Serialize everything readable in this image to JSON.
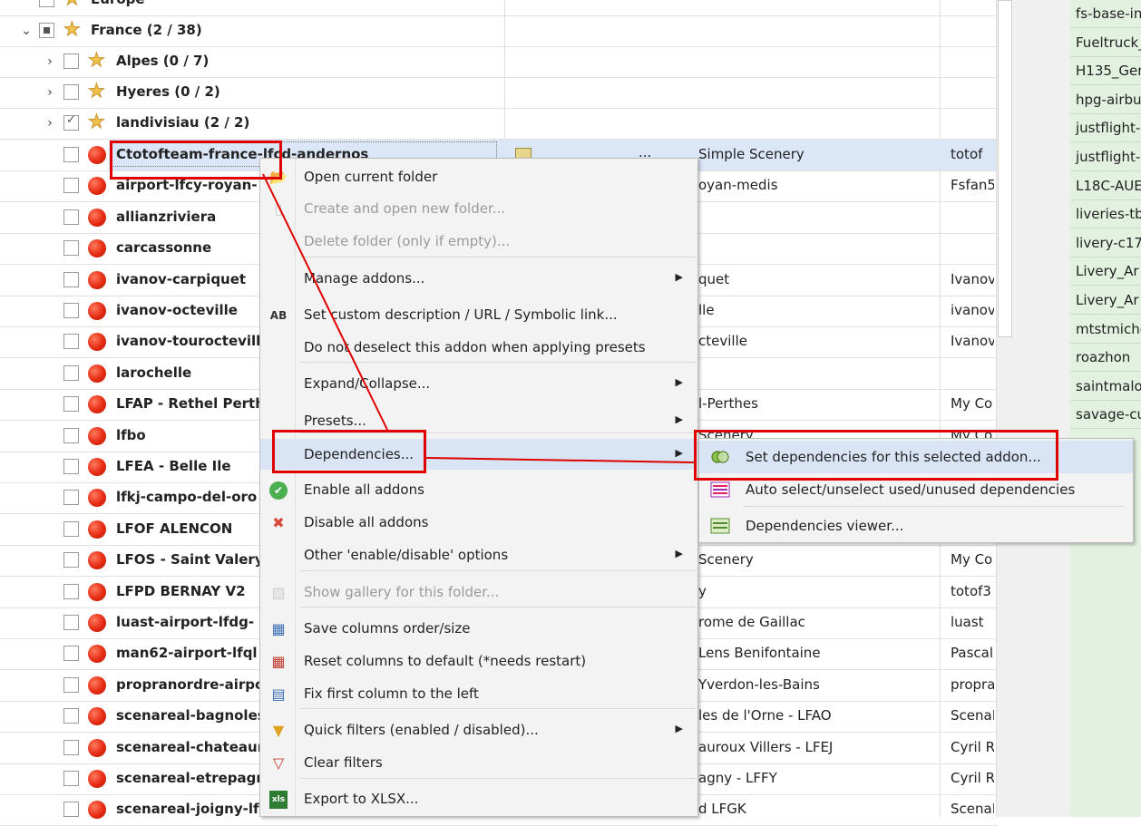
{
  "tree": {
    "partial_top_label": "Europe",
    "groups": [
      {
        "name": "France (2 / 38)",
        "state": "partial"
      },
      {
        "name": "Alpes (0 / 7)",
        "state": "unchecked"
      },
      {
        "name": "Hyeres (0 / 2)",
        "state": "unchecked"
      },
      {
        "name": "landivisiau (2 / 2)",
        "state": "checked"
      }
    ],
    "items": [
      {
        "name": "Ctotofteam-france-lfcd-andernos",
        "col1": "Simple Scenery",
        "col2": "totof",
        "has_file_icon": true,
        "dots": "..."
      },
      {
        "name": "airport-lfcy-royan-",
        "col1": "oyan-medis",
        "col2": "Fsfan5"
      },
      {
        "name": "allianzriviera",
        "col1": "",
        "col2": ""
      },
      {
        "name": "carcassonne",
        "col1": "",
        "col2": ""
      },
      {
        "name": "ivanov-carpiquet",
        "col1": "quet",
        "col2": "Ivanov"
      },
      {
        "name": "ivanov-octeville",
        "col1": "lle",
        "col2": "ivanov"
      },
      {
        "name": "ivanov-tourocteville",
        "col1": "cteville",
        "col2": "Ivanov"
      },
      {
        "name": "larochelle",
        "col1": "",
        "col2": ""
      },
      {
        "name": "LFAP - Rethel Perthes",
        "col1": "l-Perthes",
        "col2": "My Co"
      },
      {
        "name": "lfbo",
        "col1": "Scenery",
        "col2": "My Co"
      },
      {
        "name": "LFEA - Belle Ile",
        "col1": "",
        "col2": ""
      },
      {
        "name": "lfkj-campo-del-oro",
        "col1": "",
        "col2": ""
      },
      {
        "name": "LFOF ALENCON",
        "col1": "",
        "col2": ""
      },
      {
        "name": "LFOS - Saint Valery",
        "col1": "Scenery",
        "col2": "My Co"
      },
      {
        "name": "LFPD BERNAY V2",
        "col1": "y",
        "col2": "totof3"
      },
      {
        "name": "luast-airport-lfdg-",
        "col1": "rome de Gaillac",
        "col2": "luast"
      },
      {
        "name": "man62-airport-lfql",
        "col1": "Lens Benifontaine",
        "col2": "Pascal"
      },
      {
        "name": "propranordre-airport",
        "col1": "Yverdon-les-Bains",
        "col2": "propra"
      },
      {
        "name": "scenareal-bagnoles",
        "col1": "les de l'Orne - LFAO",
        "col2": "ScenaR"
      },
      {
        "name": "scenareal-chateauroux",
        "col1": "auroux Villers - LFEJ",
        "col2": "Cyril R"
      },
      {
        "name": "scenareal-etrepagny",
        "col1": "agny - LFFY",
        "col2": "Cyril R"
      },
      {
        "name": "scenareal-joigny-lfgk",
        "col1": "d LFGK",
        "col2": "ScenaR"
      }
    ]
  },
  "right_panel": {
    "items": [
      "fs-base-in",
      "Fueltruck_",
      "H135_Ger",
      "hpg-airbu",
      "justflight-",
      "justflight-",
      "L18C-AUE",
      "liveries-tb",
      "livery-c17",
      "Livery_Ar",
      "Livery_Ar",
      "mtstmiche",
      "roazhon",
      "saintmalo",
      "savage-cu"
    ]
  },
  "context_menu": {
    "items": [
      {
        "label": "Open current folder",
        "icon": "folder-open-icon",
        "disabled": false,
        "submenu": false
      },
      {
        "label": "Create and open new folder...",
        "icon": "new-folder-icon",
        "disabled": true,
        "submenu": false
      },
      {
        "label": "Delete folder (only if empty)...",
        "icon": "",
        "disabled": true,
        "submenu": false
      },
      {
        "label": "Manage addons...",
        "icon": "",
        "disabled": false,
        "submenu": true
      },
      {
        "label": "Set custom description / URL / Symbolic link...",
        "icon": "ab-text-icon",
        "disabled": false,
        "submenu": false
      },
      {
        "label": "Do not deselect this addon when applying presets",
        "icon": "",
        "disabled": false,
        "submenu": false
      },
      {
        "label": "Expand/Collapse...",
        "icon": "",
        "disabled": false,
        "submenu": true
      },
      {
        "label": "Presets...",
        "icon": "",
        "disabled": false,
        "submenu": true
      },
      {
        "label": "Dependencies...",
        "icon": "",
        "disabled": false,
        "submenu": true,
        "highlighted": true
      },
      {
        "label": "Enable all addons",
        "icon": "green-check-icon",
        "disabled": false,
        "submenu": false
      },
      {
        "label": "Disable all addons",
        "icon": "red-x-icon",
        "disabled": false,
        "submenu": false
      },
      {
        "label": "Other 'enable/disable' options",
        "icon": "",
        "disabled": false,
        "submenu": true
      },
      {
        "label": "Show gallery for this folder...",
        "icon": "gallery-icon",
        "disabled": true,
        "submenu": false
      },
      {
        "label": "Save columns order/size",
        "icon": "save-columns-icon",
        "disabled": false,
        "submenu": false
      },
      {
        "label": "Reset columns to default (*needs restart)",
        "icon": "reset-columns-icon",
        "disabled": false,
        "submenu": false
      },
      {
        "label": "Fix first column to the left",
        "icon": "fix-column-icon",
        "disabled": false,
        "submenu": false
      },
      {
        "label": "Quick filters (enabled / disabled)...",
        "icon": "filter-icon",
        "disabled": false,
        "submenu": true
      },
      {
        "label": "Clear filters",
        "icon": "clear-filter-icon",
        "disabled": false,
        "submenu": false
      },
      {
        "label": "Export to XLSX...",
        "icon": "xls-export-icon",
        "disabled": false,
        "submenu": false
      }
    ]
  },
  "submenu": {
    "items": [
      {
        "label": "Set dependencies for this selected addon...",
        "icon": "link-rings-icon",
        "highlighted": true
      },
      {
        "label": "Auto select/unselect used/unused dependencies",
        "icon": "list-select-icon"
      },
      {
        "label": "Dependencies viewer...",
        "icon": "viewer-icon"
      }
    ]
  },
  "colors": {
    "annotation_red": "#e00000",
    "highlight": "#d9e4f5",
    "right_panel_bg": "#e3f2e0"
  }
}
